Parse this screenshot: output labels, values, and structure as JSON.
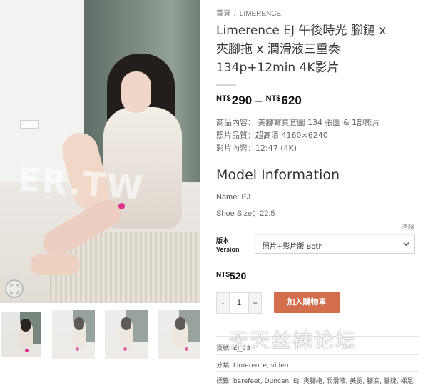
{
  "breadcrumb": {
    "home": "首頁",
    "separator": "/",
    "category": "LIMERENCE"
  },
  "product": {
    "title_line1": "Limerence EJ 午後時光 腳鏈 x",
    "title_line2": "夾腳拖 x 潤滑液三重奏",
    "title_line3": "134p+12min 4K影片",
    "price_currency": "NT$",
    "price_min": "290",
    "price_dash": "–",
    "price_max": "620"
  },
  "description": {
    "line1": "商品內容： 美腳寫真套圖 134 張圖 & 1部影片",
    "line2": "照片品質：超高清 4160×6240",
    "line3": "影片內容：12:47 (4K)"
  },
  "model": {
    "heading": "Model Information",
    "name": "Name: EJ",
    "shoe_size": "Shoe Size：22.5"
  },
  "variation": {
    "clear_label": "清除",
    "label_line1": "版本",
    "label_line2": "Version",
    "selected": "照片+影片版 Both"
  },
  "selected_price": {
    "currency": "NT$",
    "amount": "520"
  },
  "cart": {
    "minus": "-",
    "quantity": "1",
    "plus": "+",
    "add_label": "加入購物車"
  },
  "product_meta": {
    "sku_label": "貨號: ",
    "sku_value": "EJ_03",
    "categories": "分類: Limerence, video",
    "tags": "標籤: barefeet, Duncan, EJ, 夾腳拖, 潤滑液, 美腿, 腳底, 腳鏈, 裸足"
  },
  "watermarks": {
    "photo": "ER.TW",
    "forum": "天天丝袜论坛"
  },
  "gallery": {
    "thumbnail_count": 4
  },
  "colors": {
    "accent_button": "#d26e4b",
    "text_dark": "#333333",
    "watermark_dot": "#e0308f"
  }
}
